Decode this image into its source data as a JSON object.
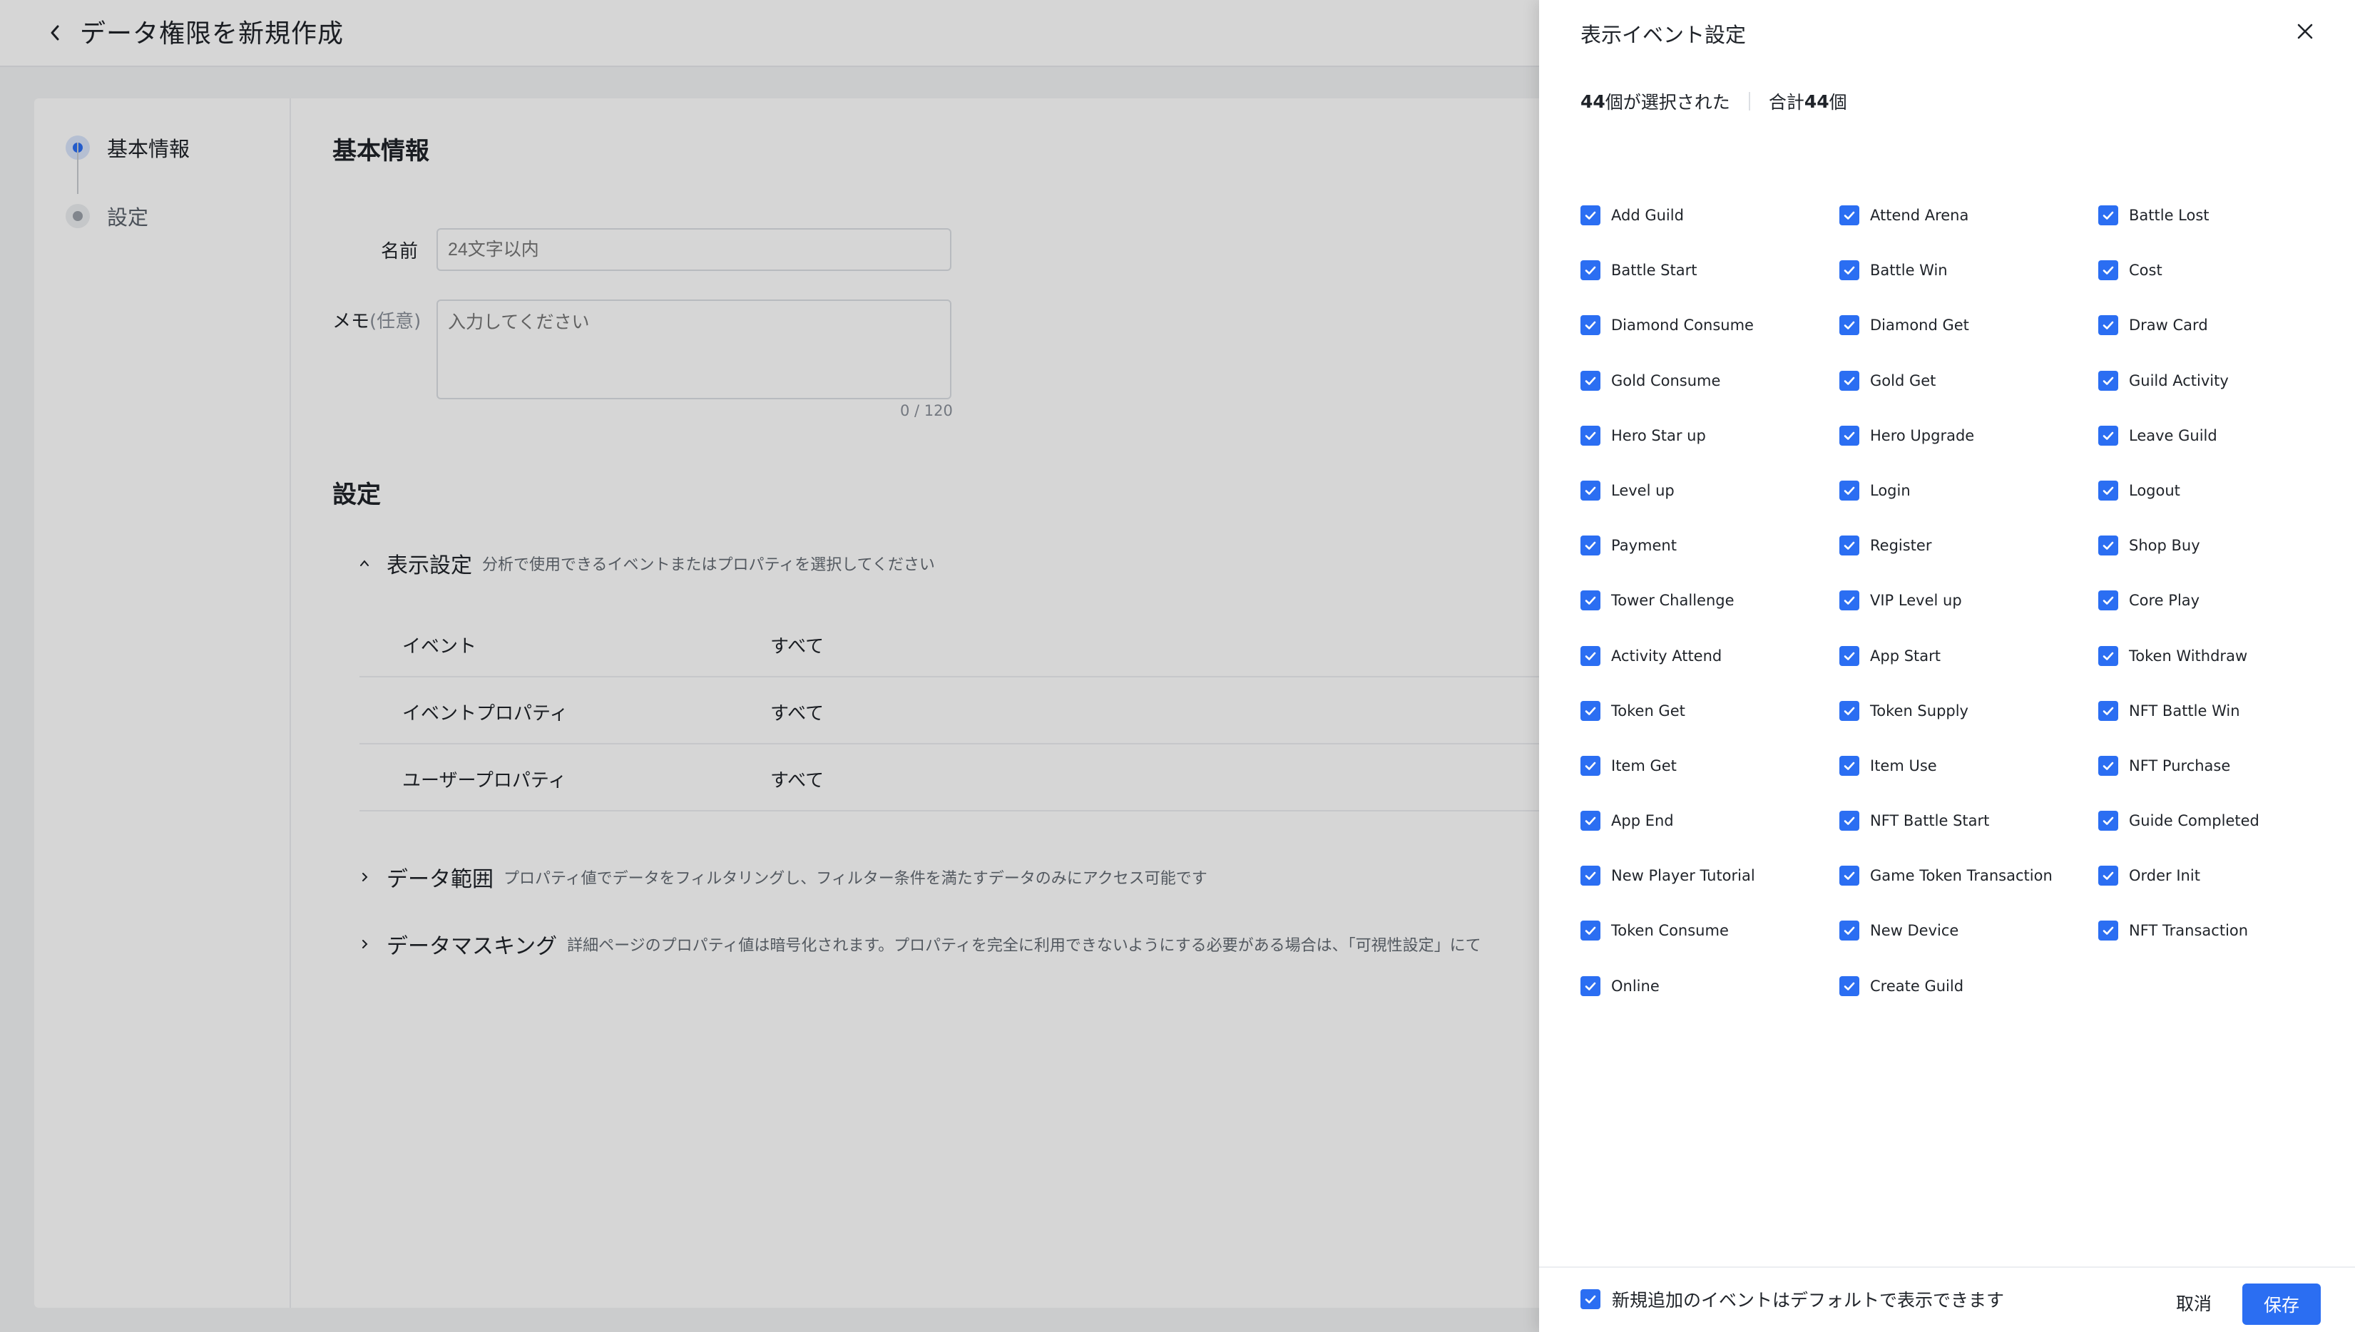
{
  "page": {
    "title": "データ権限を新規作成"
  },
  "steps": [
    {
      "label": "基本情報"
    },
    {
      "label": "設定"
    }
  ],
  "basic_info": {
    "section_title": "基本情報",
    "name_label": "名前",
    "name_placeholder": "24文字以内",
    "memo_label": "メモ",
    "memo_optional": "(任意)",
    "memo_placeholder": "入力してください",
    "memo_counter": "0 / 120"
  },
  "settings": {
    "section_title": "設定",
    "display": {
      "title": "表示設定",
      "desc": "分析で使用できるイベントまたはプロパティを選択してください",
      "rows": [
        {
          "key": "イベント",
          "value": "すべて"
        },
        {
          "key": "イベントプロパティ",
          "value": "すべて"
        },
        {
          "key": "ユーザープロパティ",
          "value": "すべて"
        }
      ]
    },
    "data_range": {
      "title": "データ範囲",
      "desc": "プロパティ値でデータをフィルタリングし、フィルター条件を満たすデータのみにアクセス可能です"
    },
    "masking": {
      "title": "データマスキング",
      "desc": "詳細ページのプロパティ値は暗号化されます。プロパティを完全に利用できないようにする必要がある場合は、「可視性設定」にて"
    }
  },
  "drawer": {
    "title": "表示イベント設定",
    "selected_count": "44",
    "selected_suffix": "個が選択された",
    "total_prefix": "合計",
    "total_count": "44",
    "total_suffix": "個",
    "events": [
      "Add Guild",
      "Attend Arena",
      "Battle Lost",
      "Battle Start",
      "Battle Win",
      "Cost",
      "Diamond Consume",
      "Diamond Get",
      "Draw Card",
      "Gold Consume",
      "Gold Get",
      "Guild Activity",
      "Hero Star up",
      "Hero Upgrade",
      "Leave Guild",
      "Level up",
      "Login",
      "Logout",
      "Payment",
      "Register",
      "Shop Buy",
      "Tower Challenge",
      "VIP Level up",
      "Core Play",
      "Activity Attend",
      "App Start",
      "Token Withdraw",
      "Token Get",
      "Token Supply",
      "NFT Battle Win",
      "Item Get",
      "Item Use",
      "NFT Purchase",
      "App End",
      "NFT Battle Start",
      "Guide Completed",
      "New Player Tutorial",
      "Game Token Transaction",
      "Order Init",
      "Token Consume",
      "New Device",
      "NFT Transaction",
      "Online",
      "Create Guild"
    ],
    "footer_check_label": "新規追加のイベントはデフォルトで表示できます",
    "cancel_label": "取消",
    "save_label": "保存"
  },
  "colors": {
    "accent": "#2b6ef2",
    "overlay": "rgba(0,0,0,0.16)"
  },
  "icons": {
    "back": "chevron-left-icon",
    "close": "close-icon",
    "checkbox": "checkmark-icon"
  }
}
